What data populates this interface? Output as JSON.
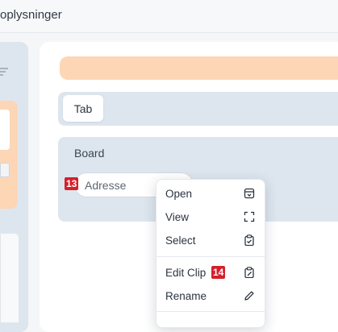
{
  "header": {
    "title": "oplysninger"
  },
  "tabs": [
    {
      "label": "Tab"
    }
  ],
  "board": {
    "title": "Board",
    "field_label": "Adresse",
    "field_badge": "13"
  },
  "context_menu": {
    "items": [
      {
        "label": "Open",
        "icon": "open-box-icon"
      },
      {
        "label": "View",
        "icon": "expand-icon"
      },
      {
        "label": "Select",
        "icon": "clipboard-check-icon"
      },
      {
        "label": "Edit Clip",
        "icon": "clipboard-edit-icon",
        "badge": "14"
      },
      {
        "label": "Rename",
        "icon": "pencil-icon"
      }
    ]
  },
  "colors": {
    "accent_peach": "#fdd6b6",
    "panel_blue": "#dde6ee",
    "badge_red": "#d4202b"
  }
}
